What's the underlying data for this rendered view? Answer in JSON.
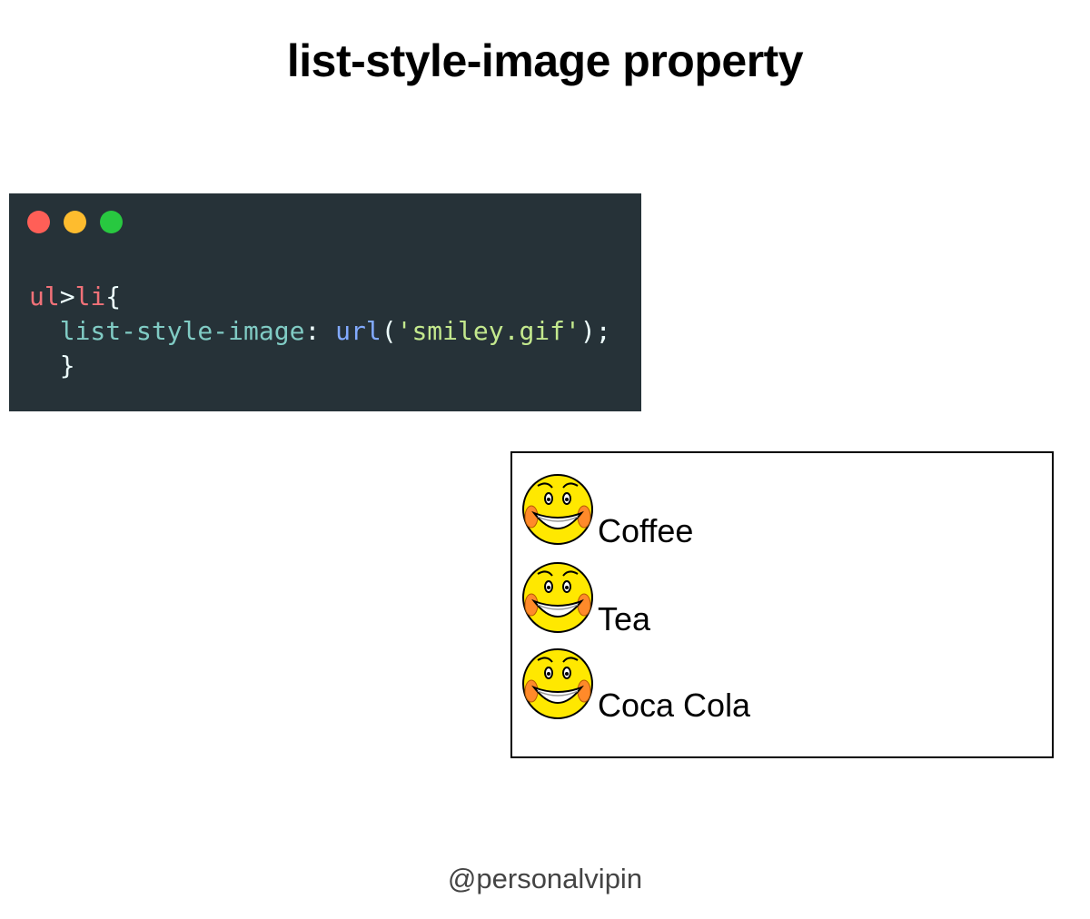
{
  "title": "list-style-image property",
  "colors": {
    "code_bg": "#263238",
    "dot_close": "#ff5f57",
    "dot_minimize": "#febc2e",
    "dot_maximize": "#28c840",
    "selector": "#f07178",
    "property": "#80cbc4",
    "function": "#82aaff",
    "string": "#c3e88d",
    "punct": "#eeffff"
  },
  "code": {
    "selector_ul": "ul",
    "combinator": ">",
    "selector_li": "li",
    "open_brace": "{",
    "property": "list-style-image",
    "colon": ":",
    "function": "url",
    "paren_open": "(",
    "string": "'smiley.gif'",
    "paren_close": ")",
    "semicolon": ";",
    "close_brace": "}"
  },
  "demo_list": {
    "marker_icon": "smiley-face-icon",
    "items": [
      "Coffee",
      "Tea",
      "Coca Cola"
    ]
  },
  "footer": {
    "handle": "@personalvipin"
  }
}
